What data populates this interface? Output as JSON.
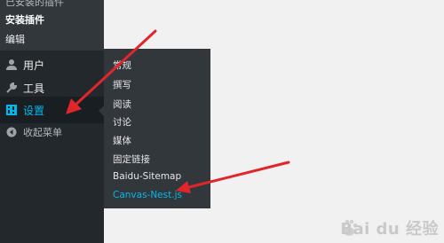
{
  "sidebar": {
    "sub_items": [
      {
        "label": "已安装的插件"
      },
      {
        "label": "安装插件"
      },
      {
        "label": "编辑"
      }
    ],
    "menu": [
      {
        "label": "用户",
        "icon": "user-icon"
      },
      {
        "label": "工具",
        "icon": "wrench-icon"
      },
      {
        "label": "设置",
        "icon": "settings-icon",
        "active": true
      },
      {
        "label": "收起菜单",
        "icon": "collapse-icon"
      }
    ]
  },
  "flyout": {
    "items": [
      {
        "label": "常规"
      },
      {
        "label": "撰写"
      },
      {
        "label": "阅读"
      },
      {
        "label": "讨论"
      },
      {
        "label": "媒体"
      },
      {
        "label": "固定链接"
      },
      {
        "label": "Baidu-Sitemap"
      },
      {
        "label": "Canvas-Nest.js",
        "current": true
      }
    ]
  },
  "watermark": {
    "text": "Bai du 经验"
  },
  "colors": {
    "sidebar_bg": "#23282d",
    "submenu_bg": "#32373c",
    "accent": "#00b9eb",
    "arrow": "#e0262b",
    "page_bg": "#f1f1f1"
  }
}
